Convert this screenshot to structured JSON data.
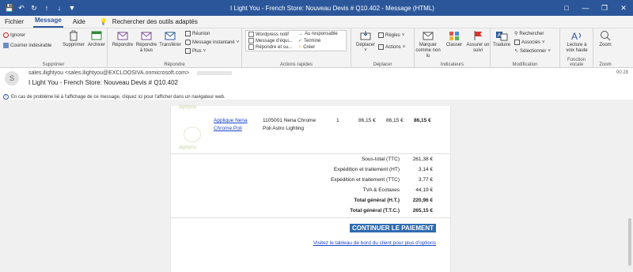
{
  "window": {
    "title": "I Light You - French Store: Nouveau Devis # Q10.402 - Message (HTML)",
    "qat_icons": [
      "save-icon",
      "undo-icon",
      "redo-icon",
      "up-icon",
      "down-icon",
      "more-icon"
    ],
    "controls": [
      "—",
      "❐",
      "✕"
    ],
    "ribbon_display_icon": "ribbon-display-icon"
  },
  "menu": {
    "items": [
      "Fichier",
      "Message",
      "Aide"
    ],
    "active": "Message",
    "tellme": "Rechercher des outils adaptés"
  },
  "ribbon": {
    "supprimer": {
      "label": "Supprimer",
      "ignorer": "Ignorer",
      "courrier": "Courrier indésirable",
      "supprimer_btn": "Supprimer",
      "archiver": "Archiver"
    },
    "repondre": {
      "label": "Répondre",
      "repondre": "Répondre",
      "repondre_tous_1": "Répondre",
      "repondre_tous_2": "à tous",
      "transferer": "Transférer",
      "reunion": "Réunion",
      "message_instantane": "Message instantané",
      "plus": "Plus"
    },
    "actions_rapides": {
      "label": "Actions rapides",
      "items": [
        "Wordpress notif",
        "Message d'équi...",
        "Répondre et su...",
        "Au responsable",
        "Terminé",
        "Créer"
      ]
    },
    "deplacer": {
      "label": "Déplacer",
      "deplacer": "Déplacer",
      "regles": "Règles",
      "actions": "Actions"
    },
    "indicateurs": {
      "label": "Indicateurs",
      "marquer_1": "Marquer",
      "marquer_2": "comme non lu",
      "classer": "Classer",
      "assurer_1": "Assurer un",
      "assurer_2": "suivi"
    },
    "modification": {
      "label": "Modification",
      "traduire": "Traduire",
      "rechercher": "Rechercher",
      "associes": "Associés",
      "selectionner": "Sélectionner"
    },
    "fonction_vocale": {
      "label": "Fonction vocale",
      "lecture_1": "Lecture à",
      "lecture_2": "voix haute"
    },
    "zoom": {
      "label": "Zoom",
      "zoom": "Zoom"
    },
    "colors": {
      "accent": "#2b579a",
      "ribbon_bg": "#f3f3f3"
    }
  },
  "message": {
    "avatar": "S",
    "from": "sales.ilightyou <sales.ilightyou@EXCLOOSIVA.onmicrosoft.com>",
    "subject": "I Light You - French Store: Nouveau Devis # Q10.402",
    "date": "00:28",
    "info": "En cas de problème lié à l'affichage de ce message, cliquez ici pour l'afficher dans un navigateur web."
  },
  "order": {
    "watermark": "ilightyou",
    "product": {
      "name_1": "Applique Nena",
      "name_2": "Chrome Poli",
      "ref_1": "1105001 Nena Chrome",
      "ref_2": "Poli Astro Lighting",
      "qty": "1",
      "price": "86,15 €",
      "price_ttc": "86,15 €",
      "total": "86,15 €"
    },
    "totals": [
      {
        "label": "Sous-total (TTC)",
        "value": "261,38 €"
      },
      {
        "label": "Expédition et traitement (HT)",
        "value": "3,14 €"
      },
      {
        "label": "Expédition et traitement (TTC)",
        "value": "3,77 €"
      },
      {
        "label": "TVA & Ecotaxes",
        "value": "44,19 €"
      },
      {
        "label": "Total général (H.T.)",
        "value": "220,96 €",
        "bold": true
      },
      {
        "label": "Total général (T.T.C.)",
        "value": "265,15 €",
        "bold": true
      }
    ],
    "cta": "CONTINUER LE PAIEMENT",
    "dashboard_link": "Visitez le tableau de bord du client pour plus d'options"
  }
}
